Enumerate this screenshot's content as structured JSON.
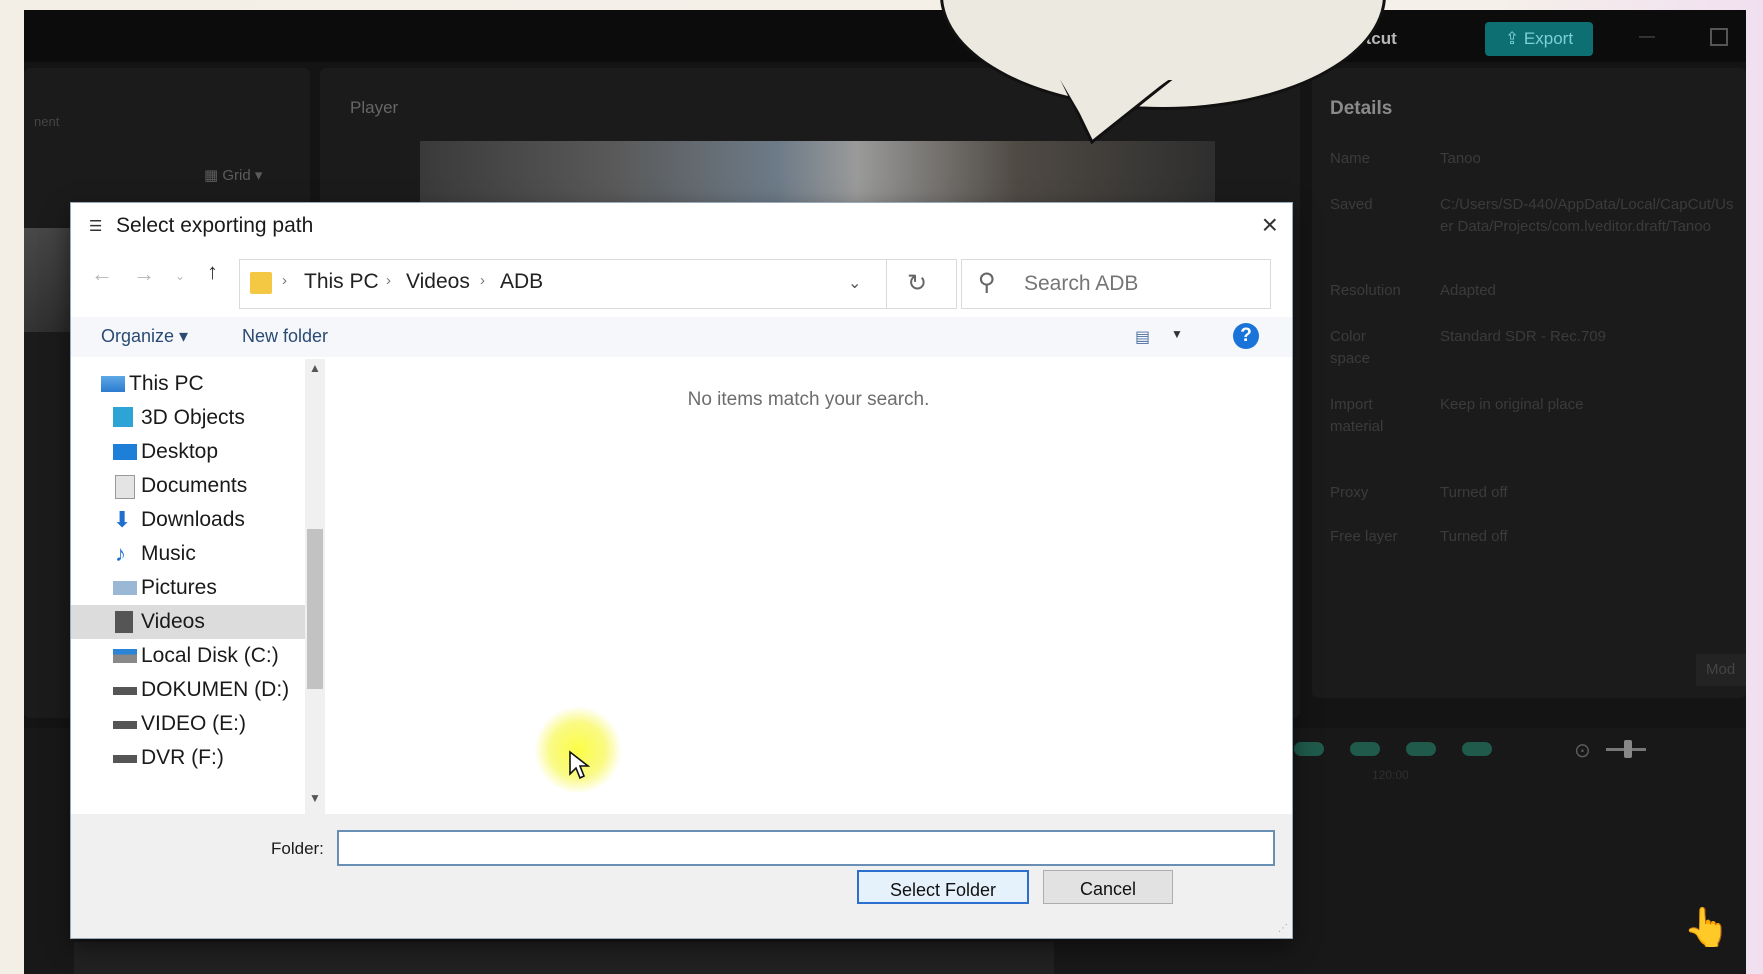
{
  "background_app": {
    "title": "",
    "shortcut_label": "rtcut",
    "export_label": "Export",
    "panels": {
      "media": {
        "tab_label": "nent",
        "grid_label": "Grid"
      },
      "player": {
        "label": "Player"
      },
      "details": {
        "title": "Details",
        "rows": [
          {
            "label": "Name",
            "value": "Tanoo"
          },
          {
            "label": "Saved",
            "value": "C:/Users/SD-440/AppData/Local/CapCut/User Data/Projects/com.lveditor.draft/Tanoo"
          },
          {
            "label": "Resolution",
            "value": "Adapted"
          },
          {
            "label": "Color space",
            "value": "Standard SDR - Rec.709"
          },
          {
            "label": "Import material",
            "value": "Keep in original place"
          },
          {
            "label": "Proxy",
            "value": "Turned off"
          },
          {
            "label": "Free layer",
            "value": "Turned off"
          }
        ],
        "modify_label": "Mod"
      }
    },
    "timeline": {
      "time_label": "120:00"
    }
  },
  "dialog": {
    "title": "Select exporting path",
    "breadcrumb": [
      "This PC",
      "Videos",
      "ADB"
    ],
    "search_placeholder": "Search ADB",
    "toolbar": {
      "organize": "Organize",
      "new_folder": "New folder"
    },
    "nav_tree": [
      {
        "label": "This PC",
        "icon": "monitor-icon",
        "indent": 0
      },
      {
        "label": "3D Objects",
        "icon": "cube-icon",
        "indent": 1
      },
      {
        "label": "Desktop",
        "icon": "desktop-icon",
        "indent": 1
      },
      {
        "label": "Documents",
        "icon": "document-icon",
        "indent": 1
      },
      {
        "label": "Downloads",
        "icon": "download-icon",
        "indent": 1
      },
      {
        "label": "Music",
        "icon": "music-icon",
        "indent": 1
      },
      {
        "label": "Pictures",
        "icon": "picture-icon",
        "indent": 1
      },
      {
        "label": "Videos",
        "icon": "video-icon",
        "indent": 1,
        "selected": true
      },
      {
        "label": "Local Disk (C:)",
        "icon": "disk-icon",
        "indent": 1
      },
      {
        "label": "DOKUMEN (D:)",
        "icon": "drive-icon",
        "indent": 1
      },
      {
        "label": "VIDEO (E:)",
        "icon": "drive-icon",
        "indent": 1
      },
      {
        "label": "DVR (F:)",
        "icon": "drive-icon",
        "indent": 1
      }
    ],
    "empty_message": "No items match your search.",
    "folder_label": "Folder:",
    "folder_value": "",
    "select_button": "Select Folder",
    "cancel_button": "Cancel"
  },
  "colors": {
    "export_teal": "#0e6f72",
    "help_blue": "#1a73d9",
    "selection_gray": "#dcdcdc",
    "highlight_yellow": "#fcfc3c"
  }
}
